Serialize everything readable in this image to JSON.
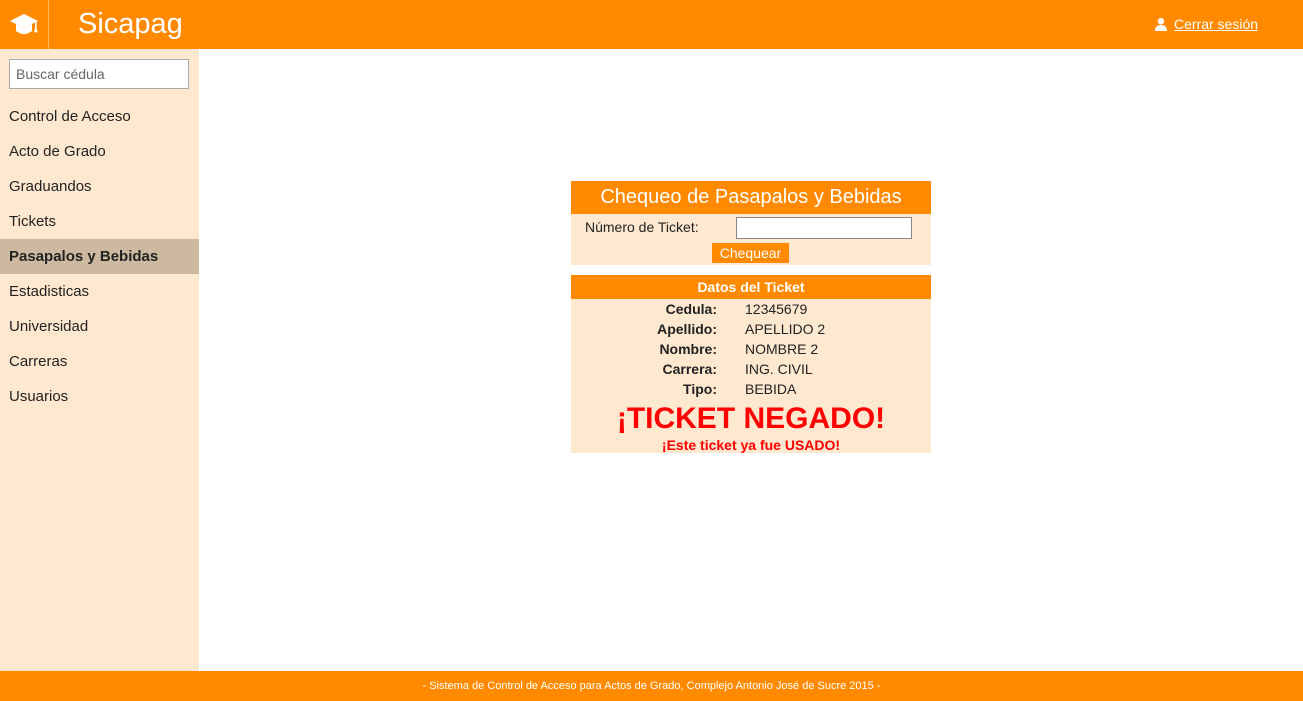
{
  "app": {
    "brand": "Sicapag",
    "logo_icon": "graduation-cap-icon",
    "logout_label": "Cerrar sesión",
    "logout_icon": "user-icon",
    "accent_color": "#ff8a00"
  },
  "sidebar": {
    "search_placeholder": "Buscar cédula",
    "items": [
      {
        "label": "Control de Acceso"
      },
      {
        "label": "Acto de Grado"
      },
      {
        "label": "Graduandos"
      },
      {
        "label": "Tickets"
      },
      {
        "label": "Pasapalos y Bebidas",
        "active": true
      },
      {
        "label": "Estadisticas"
      },
      {
        "label": "Universidad"
      },
      {
        "label": "Carreras"
      },
      {
        "label": "Usuarios"
      }
    ]
  },
  "check_panel": {
    "title": "Chequeo de Pasapalos y Bebidas",
    "ticket_label": "Número de Ticket:",
    "ticket_value": "",
    "button_label": "Chequear"
  },
  "data_panel": {
    "title": "Datos del Ticket",
    "rows": [
      {
        "key": "Cedula:",
        "value": "12345679"
      },
      {
        "key": "Apellido:",
        "value": "APELLIDO 2"
      },
      {
        "key": "Nombre:",
        "value": "NOMBRE 2"
      },
      {
        "key": "Carrera:",
        "value": "ING. CIVIL"
      },
      {
        "key": "Tipo:",
        "value": "BEBIDA"
      }
    ],
    "status": "¡TICKET NEGADO!",
    "status_detail": "¡Este ticket ya fue USADO!",
    "status_color": "#ff0000"
  },
  "footer": {
    "text": "-  Sistema de Control de Acceso para Actos de Grado, Complejo Antonio José de Sucre 2015  -"
  }
}
